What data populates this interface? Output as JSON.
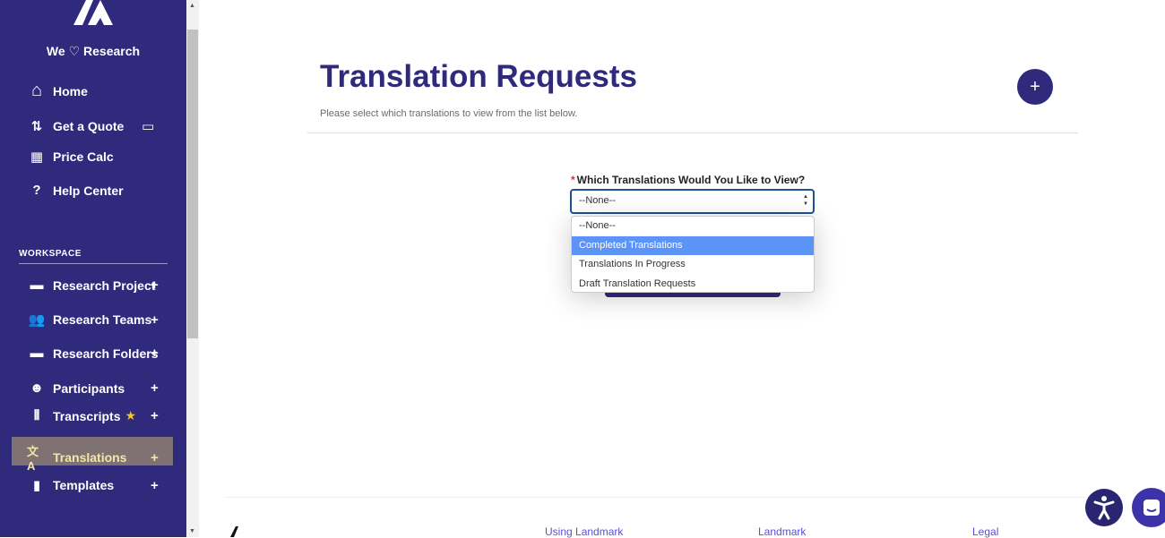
{
  "sidebar": {
    "tagline_we": "We",
    "tagline_research": "Research",
    "items": [
      {
        "label": "Home",
        "icon": "home-icon"
      },
      {
        "label": "Get a Quote",
        "icon": "sliders-icon"
      },
      {
        "label": "Price Calc",
        "icon": "calculator-icon"
      },
      {
        "label": "Help Center",
        "icon": "question-icon"
      }
    ],
    "workspace_label": "WORKSPACE",
    "workspace": [
      {
        "label": "Research Project",
        "icon": "drive-icon"
      },
      {
        "label": "Research Teams",
        "icon": "users-icon"
      },
      {
        "label": "Research Folders",
        "icon": "folder-icon"
      },
      {
        "label": "Participants",
        "icon": "people-group-icon"
      },
      {
        "label": "Transcripts",
        "icon": "waveform-icon"
      },
      {
        "label": "Translations",
        "icon": "translate-icon",
        "active": true
      },
      {
        "label": "Templates",
        "icon": "file-icon"
      }
    ],
    "plus": "+"
  },
  "main": {
    "title": "Translation Requests",
    "subtitle": "Please select which translations to view from the list below.",
    "add_button": "+",
    "field_label": "Which Translations Would You Like to View?",
    "required_mark": "*",
    "select_value": "--None--",
    "options": [
      "--None--",
      "Completed Translations",
      "Translations In Progress",
      "Draft Translation Requests"
    ],
    "highlighted_option": "Completed Translations"
  },
  "footer": {
    "links": [
      "Using Landmark",
      "Landmark",
      "Legal"
    ]
  },
  "colors": {
    "brand": "#302a7d",
    "active_item": "#7f7272",
    "highlight": "#5b93f7"
  }
}
